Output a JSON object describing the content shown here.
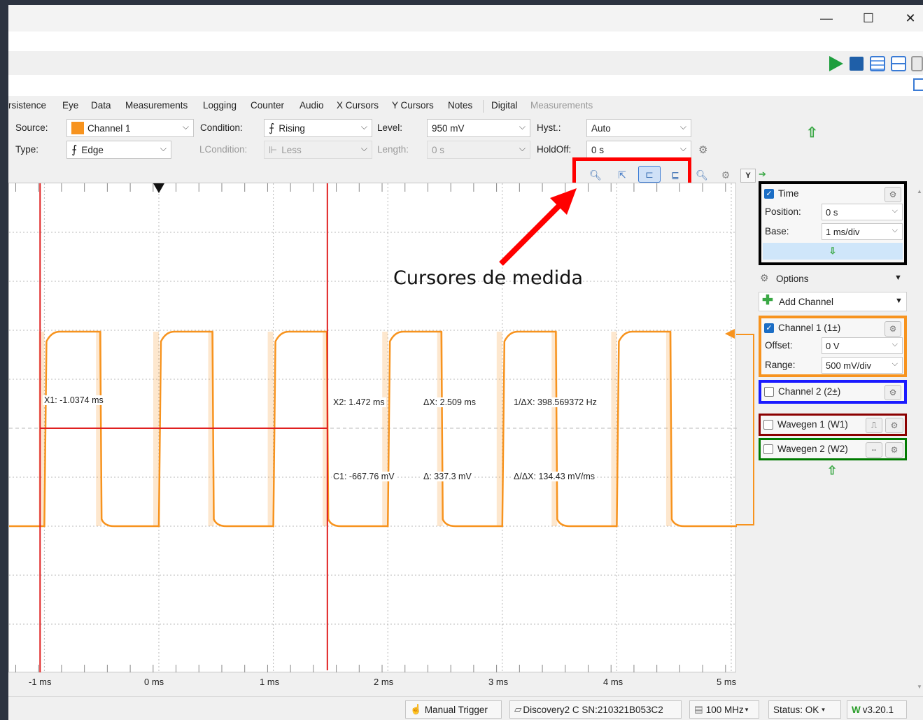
{
  "window": {
    "minimize": "—",
    "maximize": "☐",
    "close": "✕"
  },
  "tabs": [
    "rsistence",
    "Eye",
    "Data",
    "Measurements",
    "Logging",
    "Counter",
    "Audio",
    "X Cursors",
    "Y Cursors",
    "Notes",
    "Digital",
    "Measurements"
  ],
  "trigger": {
    "source_label": "Source:",
    "source_value": "Channel 1",
    "type_label": "Type:",
    "type_value": "Edge",
    "condition_label": "Condition:",
    "condition_value": "Rising",
    "lcondition_label": "LCondition:",
    "lcondition_value": "Less",
    "level_label": "Level:",
    "level_value": "950 mV",
    "length_label": "Length:",
    "length_value": "0 s",
    "hyst_label": "Hyst.:",
    "hyst_value": "Auto",
    "holdoff_label": "HoldOff:",
    "holdoff_value": "0 s"
  },
  "plot_toolbar": {
    "y_button": "Y"
  },
  "annotation": {
    "text": "Cursores de medida",
    "highlight_color": "#ff0000"
  },
  "cursors": {
    "x1": "X1: -1.0374 ms",
    "x2": "X2: 1.472 ms",
    "dx": "ΔX: 2.509 ms",
    "inv_dx": "1/ΔX: 398.569372 Hz",
    "c1": "C1: -667.76 mV",
    "dy": "Δ: 337.3 mV",
    "slope": "Δ/ΔX: 134.43 mV/ms"
  },
  "x_axis_ticks": [
    "-1 ms",
    "0 ms",
    "1 ms",
    "2 ms",
    "3 ms",
    "4 ms",
    "5 ms"
  ],
  "signal": {
    "color": "#f7931e",
    "cursor_color": "#e02020"
  },
  "side": {
    "time_title": "Time",
    "position_label": "Position:",
    "position_value": "0 s",
    "base_label": "Base:",
    "base_value": "1 ms/div",
    "options": "Options",
    "add_channel": "Add Channel",
    "ch1_title": "Channel 1 (1±)",
    "offset_label": "Offset:",
    "offset_value": "0 V",
    "range_label": "Range:",
    "range_value": "500 mV/div",
    "ch2_title": "Channel 2 (2±)",
    "w1_title": "Wavegen 1 (W1)",
    "w2_title": "Wavegen 2 (W2)",
    "box_colors": {
      "time": "#000000",
      "ch1": "#f7931e",
      "ch2": "#1a1aff",
      "w1": "#8b0000",
      "w2": "#007a00"
    }
  },
  "status": {
    "manual_trigger": "Manual Trigger",
    "device": "Discovery2 C SN:210321B053C2",
    "freq": "100 MHz",
    "status": "Status: OK",
    "version": "v3.20.1"
  }
}
